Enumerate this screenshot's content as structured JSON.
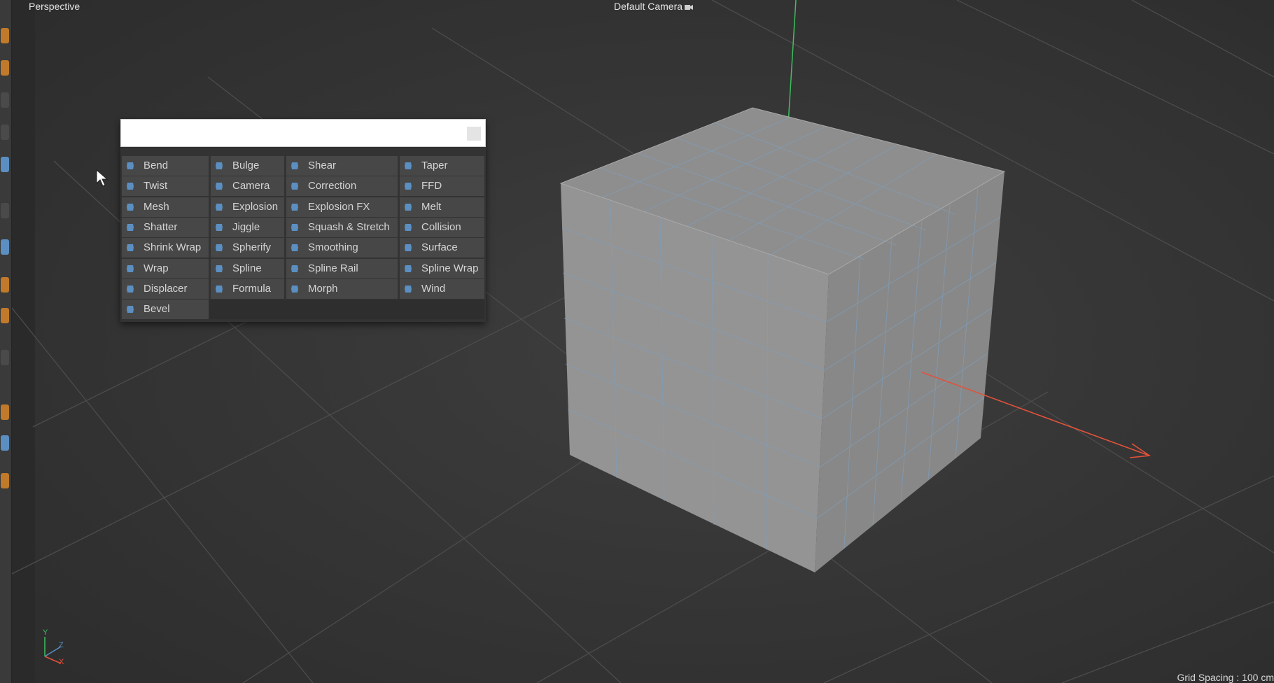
{
  "viewport": {
    "name": "Perspective",
    "camera": "Default Camera",
    "grid_spacing": "Grid Spacing : 100 cm",
    "axis_labels": [
      "Y",
      "Z",
      "X"
    ]
  },
  "deformer_popup": {
    "search_value": "",
    "items": [
      {
        "label": "Bend",
        "icon": "bend-icon"
      },
      {
        "label": "Bulge",
        "icon": "bulge-icon"
      },
      {
        "label": "Shear",
        "icon": "shear-icon"
      },
      {
        "label": "Taper",
        "icon": "taper-icon"
      },
      {
        "label": "Twist",
        "icon": "twist-icon"
      },
      {
        "label": "Camera",
        "icon": "camera-icon"
      },
      {
        "label": "Correction",
        "icon": "correction-icon"
      },
      {
        "label": "FFD",
        "icon": "ffd-icon"
      },
      {
        "label": "Mesh",
        "icon": "mesh-icon"
      },
      {
        "label": "Explosion",
        "icon": "explosion-icon"
      },
      {
        "label": "Explosion FX",
        "icon": "explosion-fx-icon"
      },
      {
        "label": "Melt",
        "icon": "melt-icon"
      },
      {
        "label": "Shatter",
        "icon": "shatter-icon"
      },
      {
        "label": "Jiggle",
        "icon": "jiggle-icon"
      },
      {
        "label": "Squash & Stretch",
        "icon": "squash-stretch-icon"
      },
      {
        "label": "Collision",
        "icon": "collision-icon"
      },
      {
        "label": "Shrink Wrap",
        "icon": "shrink-wrap-icon"
      },
      {
        "label": "Spherify",
        "icon": "spherify-icon"
      },
      {
        "label": "Smoothing",
        "icon": "smoothing-icon"
      },
      {
        "label": "Surface",
        "icon": "surface-icon"
      },
      {
        "label": "Wrap",
        "icon": "wrap-icon"
      },
      {
        "label": "Spline",
        "icon": "spline-icon"
      },
      {
        "label": "Spline Rail",
        "icon": "spline-rail-icon"
      },
      {
        "label": "Spline Wrap",
        "icon": "spline-wrap-icon"
      },
      {
        "label": "Displacer",
        "icon": "displacer-icon"
      },
      {
        "label": "Formula",
        "icon": "formula-icon"
      },
      {
        "label": "Morph",
        "icon": "morph-icon"
      },
      {
        "label": "Wind",
        "icon": "wind-icon"
      },
      {
        "label": "Bevel",
        "icon": "bevel-icon"
      }
    ]
  },
  "colors": {
    "accent_blue": "#5b8fc2",
    "y_axis": "#3fbf5f",
    "x_axis": "#e2523a"
  }
}
